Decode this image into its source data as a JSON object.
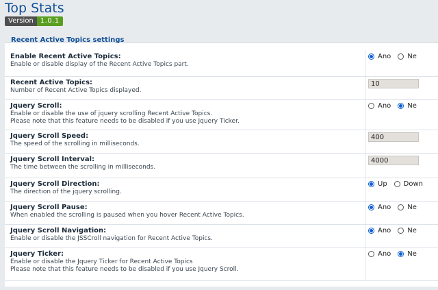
{
  "header": {
    "title": "Top Stats",
    "version_label": "Version",
    "version_value": "1.0.1"
  },
  "section_title": "Recent Active Topics settings",
  "settings": [
    {
      "title": "Enable Recent Active Topics:",
      "desc": [
        "Enable or disable display of the Recent Active Topics part."
      ],
      "control": "radio",
      "options": [
        "Ano",
        "Ne"
      ],
      "selected": "Ano"
    },
    {
      "title": "Recent Active Topics:",
      "desc": [
        "Number of Recent Active Topics displayed."
      ],
      "control": "input",
      "value": "10"
    },
    {
      "title": "Jquery Scroll:",
      "desc": [
        "Enable or disable the use of jquery scrolling Recent Active Topics.",
        "Please note that this feature needs to be disabled if you use Jquery Ticker."
      ],
      "control": "radio",
      "options": [
        "Ano",
        "Ne"
      ],
      "selected": "Ne"
    },
    {
      "title": "Jquery Scroll Speed:",
      "desc": [
        "The speed of the scrolling in milliseconds."
      ],
      "control": "input",
      "value": "400"
    },
    {
      "title": "Jquery Scroll Interval:",
      "desc": [
        "The time between the scrolling in milliseconds."
      ],
      "control": "input",
      "value": "4000"
    },
    {
      "title": "Jquery Scroll Direction:",
      "desc": [
        "The direction of the jquery scrolling."
      ],
      "control": "radio",
      "options": [
        "Up",
        "Down"
      ],
      "selected": "Up"
    },
    {
      "title": "Jquery Scroll Pause:",
      "desc": [
        "When enabled the scrolling is paused when you hover Recent Active Topics."
      ],
      "control": "radio",
      "options": [
        "Ano",
        "Ne"
      ],
      "selected": "Ano"
    },
    {
      "title": "Jquery Scroll Navigation:",
      "desc": [
        "Enable or disable the JSSCroll navigation for Recent Active Topics."
      ],
      "control": "radio",
      "options": [
        "Ano",
        "Ne"
      ],
      "selected": "Ano"
    },
    {
      "title": "Jquery Ticker:",
      "desc": [
        "Enable or disable the Jquery Ticker for Recent Active Topics",
        "Please note that this feature needs to be disabled if you use Jquery Scroll."
      ],
      "control": "radio",
      "options": [
        "Ano",
        "Ne"
      ],
      "selected": "Ne"
    }
  ]
}
